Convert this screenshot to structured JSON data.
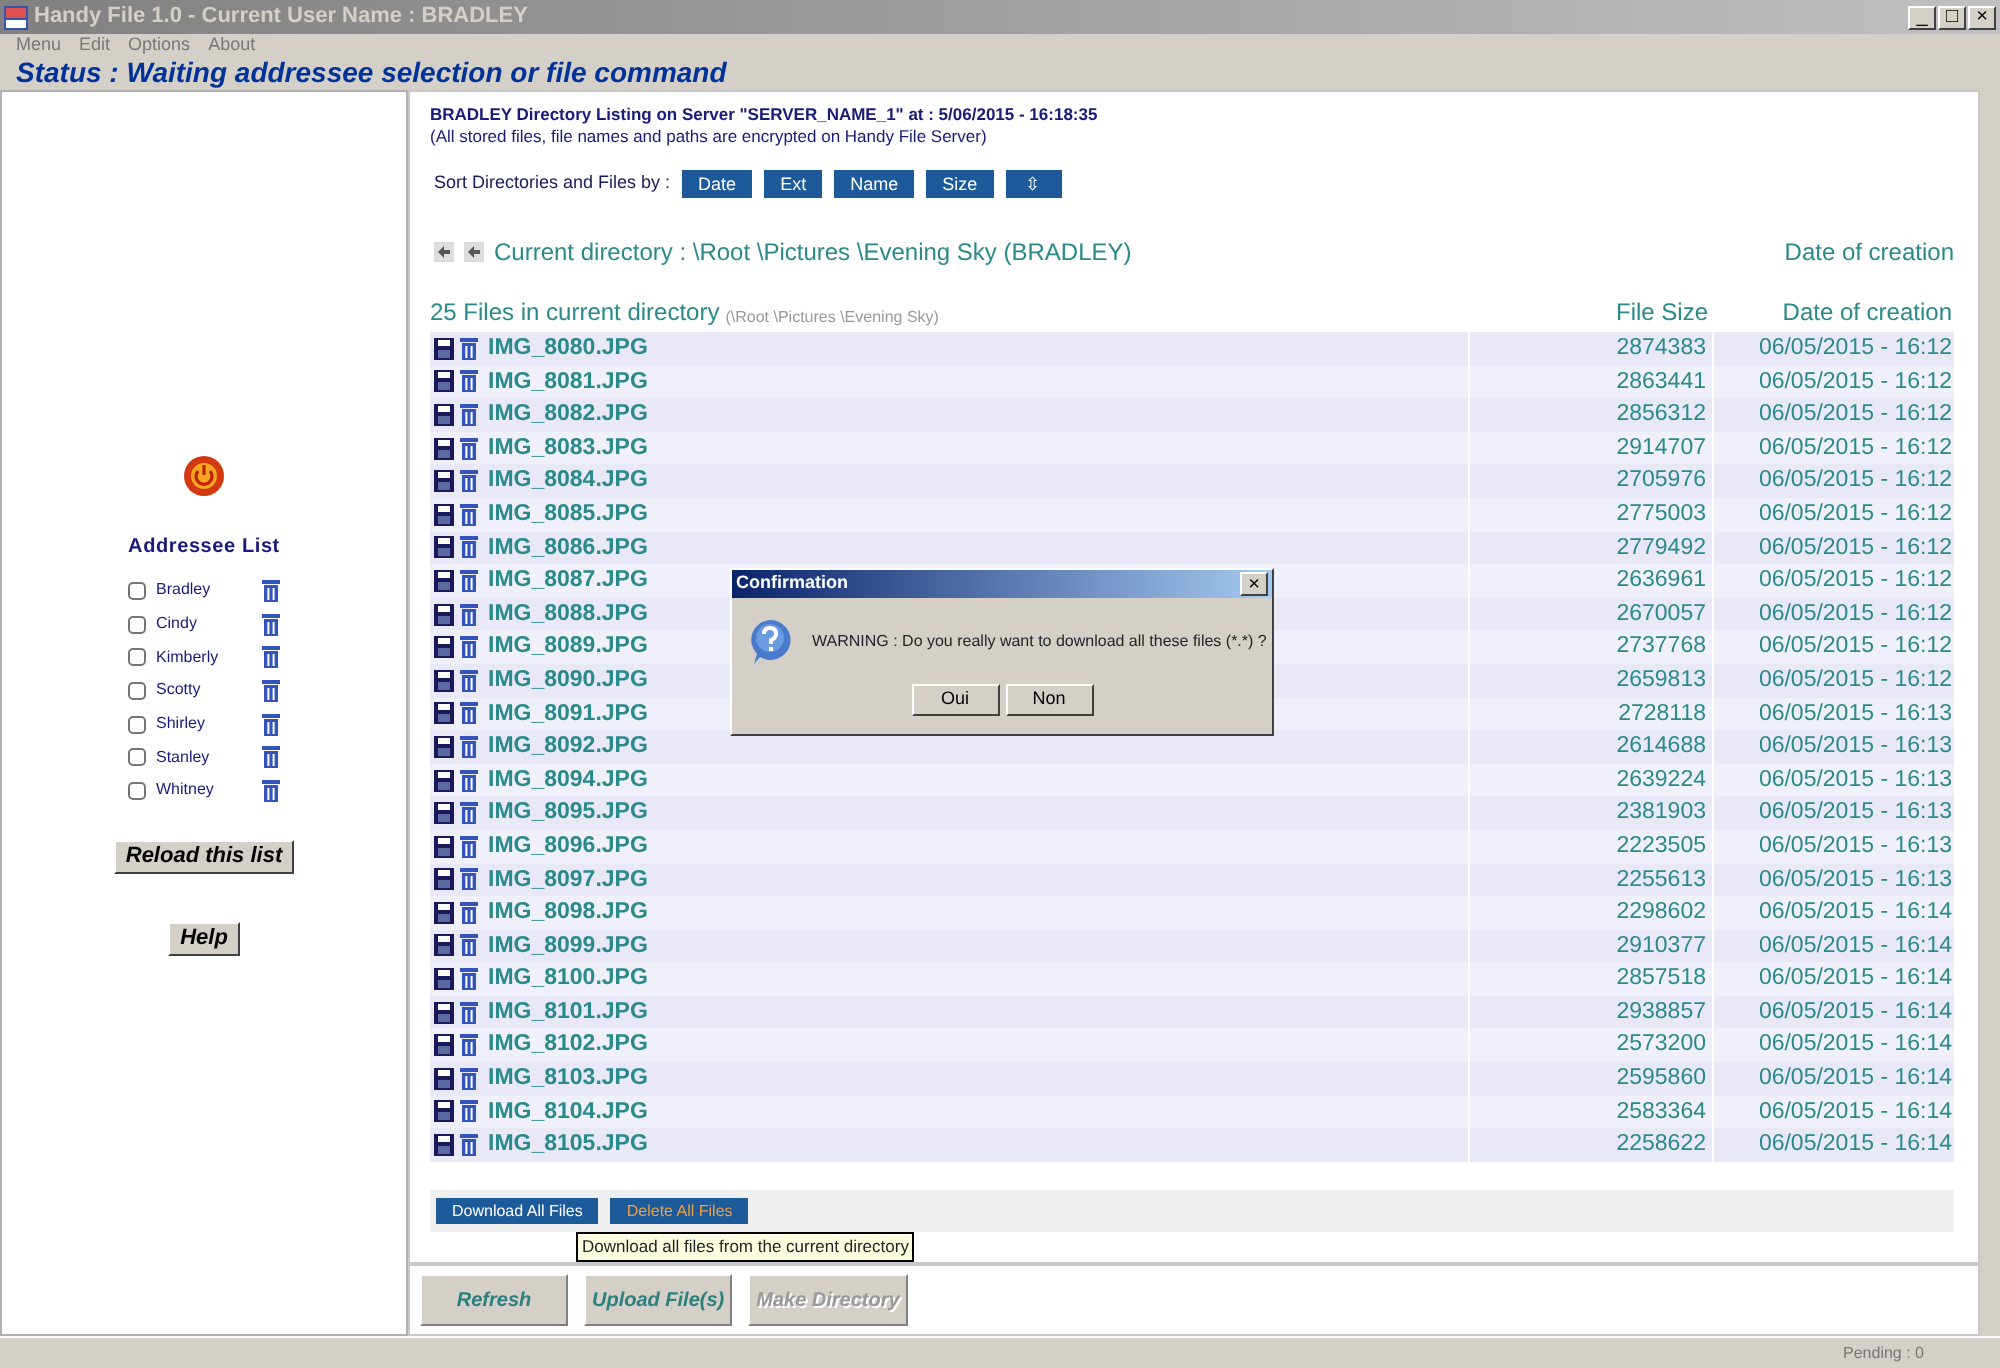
{
  "window": {
    "title": "Handy File 1.0 - Current User Name : BRADLEY",
    "controls": [
      "_",
      "□",
      "×"
    ]
  },
  "menu": [
    "Menu",
    "Edit",
    "Options",
    "About"
  ],
  "status": "Status : Waiting addressee selection or file command",
  "sidebar": {
    "title": "Addressee List",
    "addressees": [
      {
        "name": "Bradley",
        "checked": false
      },
      {
        "name": "Cindy",
        "checked": false
      },
      {
        "name": "Kimberly",
        "checked": false
      },
      {
        "name": "Scotty",
        "checked": false
      },
      {
        "name": "Shirley",
        "checked": false
      },
      {
        "name": "Stanley",
        "checked": false
      },
      {
        "name": "Whitney",
        "checked": false
      }
    ],
    "buttons": [
      "Reload this list",
      "Help"
    ]
  },
  "listing": {
    "heading": "BRADLEY Directory Listing on Server \"SERVER_NAME_1\" at : 5/06/2015 - 16:18:35",
    "note": "(All stored files, file names and paths are encrypted on Handy File Server)",
    "sort_label": "Sort Directories and Files by :",
    "sort_buttons": [
      "Date",
      "Ext",
      "Name",
      "Size",
      "⇳"
    ],
    "current_directory": "Current directory : \\Root \\Pictures \\Evening Sky (BRADLEY)",
    "date_heading": "Date of creation",
    "count": "25 Files in current directory",
    "count_path": "(\\Root \\Pictures \\Evening Sky)",
    "columns": [
      "File Size",
      "Date of creation"
    ],
    "files": [
      {
        "name": "IMG_8080.JPG",
        "size": "2874383",
        "date": "06/05/2015 - 16:12"
      },
      {
        "name": "IMG_8081.JPG",
        "size": "2863441",
        "date": "06/05/2015 - 16:12"
      },
      {
        "name": "IMG_8082.JPG",
        "size": "2856312",
        "date": "06/05/2015 - 16:12"
      },
      {
        "name": "IMG_8083.JPG",
        "size": "2914707",
        "date": "06/05/2015 - 16:12"
      },
      {
        "name": "IMG_8084.JPG",
        "size": "2705976",
        "date": "06/05/2015 - 16:12"
      },
      {
        "name": "IMG_8085.JPG",
        "size": "2775003",
        "date": "06/05/2015 - 16:12"
      },
      {
        "name": "IMG_8086.JPG",
        "size": "2779492",
        "date": "06/05/2015 - 16:12"
      },
      {
        "name": "IMG_8087.JPG",
        "size": "2636961",
        "date": "06/05/2015 - 16:12"
      },
      {
        "name": "IMG_8088.JPG",
        "size": "2670057",
        "date": "06/05/2015 - 16:12"
      },
      {
        "name": "IMG_8089.JPG",
        "size": "2737768",
        "date": "06/05/2015 - 16:12"
      },
      {
        "name": "IMG_8090.JPG",
        "size": "2659813",
        "date": "06/05/2015 - 16:12"
      },
      {
        "name": "IMG_8091.JPG",
        "size": "2728118",
        "date": "06/05/2015 - 16:13"
      },
      {
        "name": "IMG_8092.JPG",
        "size": "2614688",
        "date": "06/05/2015 - 16:13"
      },
      {
        "name": "IMG_8094.JPG",
        "size": "2639224",
        "date": "06/05/2015 - 16:13"
      },
      {
        "name": "IMG_8095.JPG",
        "size": "2381903",
        "date": "06/05/2015 - 16:13"
      },
      {
        "name": "IMG_8096.JPG",
        "size": "2223505",
        "date": "06/05/2015 - 16:13"
      },
      {
        "name": "IMG_8097.JPG",
        "size": "2255613",
        "date": "06/05/2015 - 16:13"
      },
      {
        "name": "IMG_8098.JPG",
        "size": "2298602",
        "date": "06/05/2015 - 16:14"
      },
      {
        "name": "IMG_8099.JPG",
        "size": "2910377",
        "date": "06/05/2015 - 16:14"
      },
      {
        "name": "IMG_8100.JPG",
        "size": "2857518",
        "date": "06/05/2015 - 16:14"
      },
      {
        "name": "IMG_8101.JPG",
        "size": "2938857",
        "date": "06/05/2015 - 16:14"
      },
      {
        "name": "IMG_8102.JPG",
        "size": "2573200",
        "date": "06/05/2015 - 16:14"
      },
      {
        "name": "IMG_8103.JPG",
        "size": "2595860",
        "date": "06/05/2015 - 16:14"
      },
      {
        "name": "IMG_8104.JPG",
        "size": "2583364",
        "date": "06/05/2015 - 16:14"
      },
      {
        "name": "IMG_8105.JPG",
        "size": "2258622",
        "date": "06/05/2015 - 16:14"
      }
    ],
    "actions": [
      {
        "label": "Download All Files",
        "kind": "download"
      },
      {
        "label": "Delete All Files",
        "kind": "delete"
      }
    ],
    "tooltip": "Download all files from the current directory"
  },
  "bottom_buttons": [
    {
      "label": "Refresh",
      "disabled": false
    },
    {
      "label": "Upload File(s)",
      "disabled": false
    },
    {
      "label": "Make Directory",
      "disabled": true
    }
  ],
  "status_bar": "Pending : 0",
  "dialog": {
    "title": "Confirmation",
    "message": "WARNING : Do you really want to download all these files (*.*) ?",
    "buttons": [
      "Oui",
      "Non"
    ],
    "close": "×"
  }
}
